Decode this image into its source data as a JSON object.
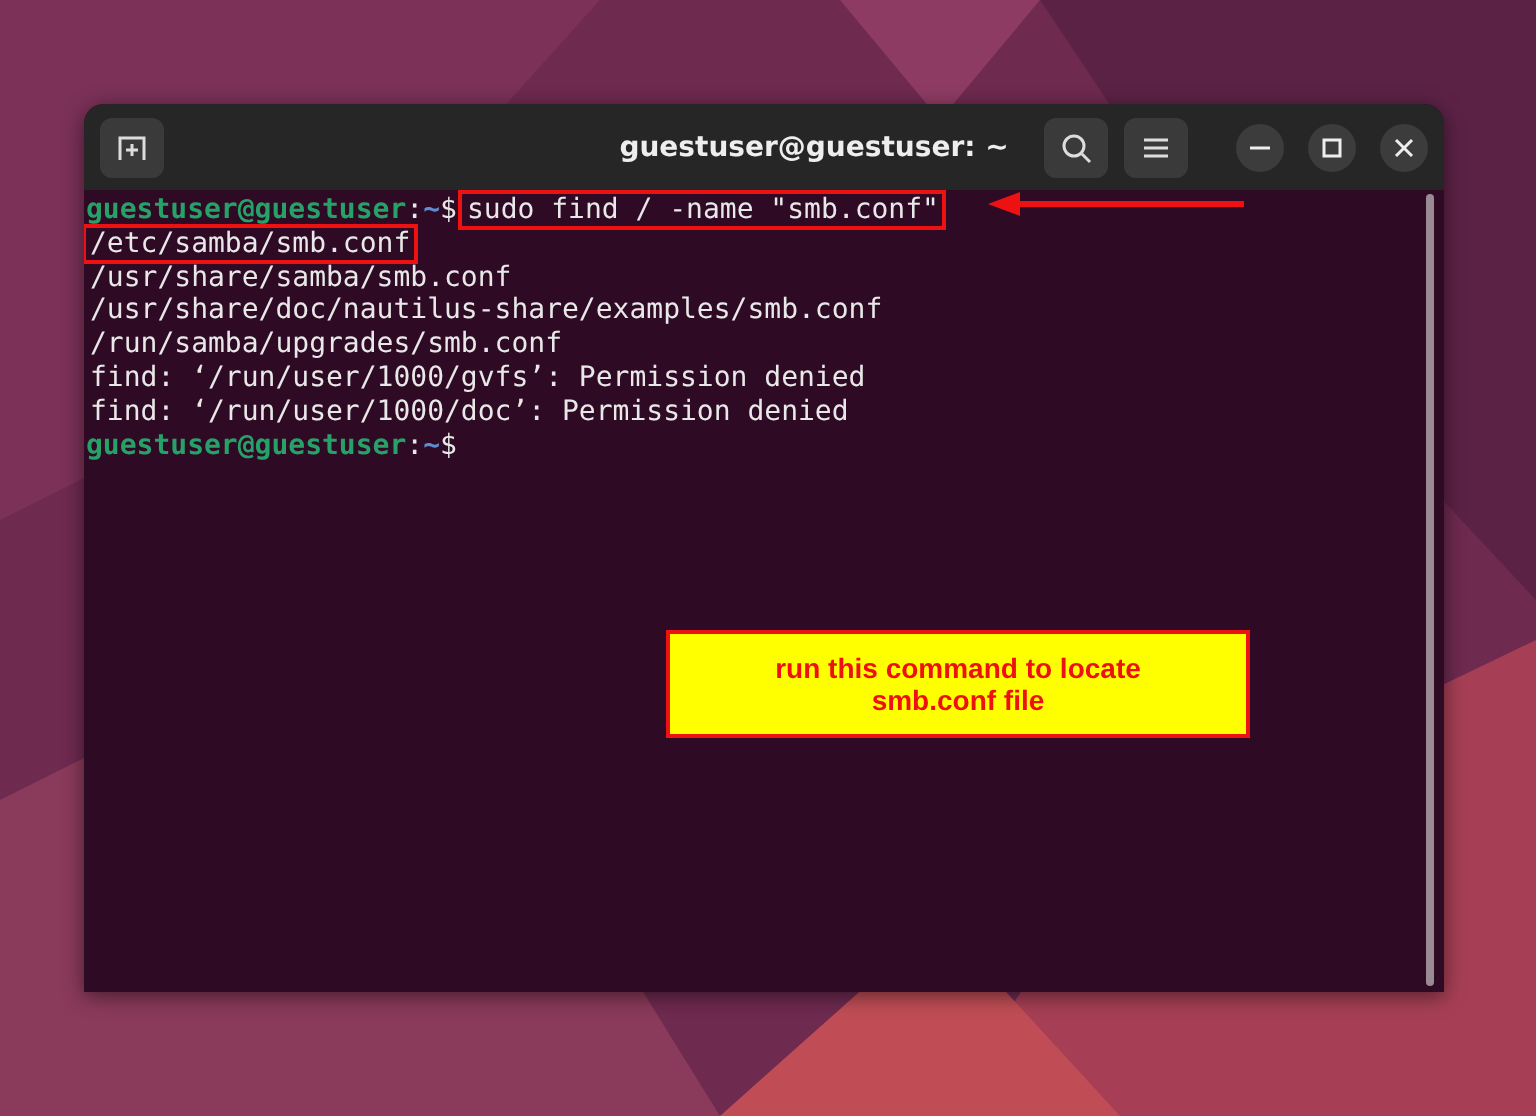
{
  "window": {
    "title": "guestuser@guestuser: ~"
  },
  "lines": [
    {
      "kind": "prompt",
      "user": "guestuser@guestuser",
      "sep": ":",
      "path": "~",
      "sign": "$",
      "command": "sudo find / -name \"smb.conf\"",
      "highlighted": true
    },
    {
      "kind": "output",
      "text": "/etc/samba/smb.conf",
      "highlighted": true
    },
    {
      "kind": "output",
      "text": "/usr/share/samba/smb.conf",
      "highlighted": false
    },
    {
      "kind": "output",
      "text": "/usr/share/doc/nautilus-share/examples/smb.conf",
      "highlighted": false
    },
    {
      "kind": "output",
      "text": "/run/samba/upgrades/smb.conf",
      "highlighted": false
    },
    {
      "kind": "output",
      "text": "find: ‘/run/user/1000/gvfs’: Permission denied",
      "highlighted": false
    },
    {
      "kind": "output",
      "text": "find: ‘/run/user/1000/doc’: Permission denied",
      "highlighted": false
    },
    {
      "kind": "prompt",
      "user": "guestuser@guestuser",
      "sep": ":",
      "path": "~",
      "sign": "$"
    }
  ],
  "callout": {
    "text": "run this command to locate smb.conf file"
  }
}
